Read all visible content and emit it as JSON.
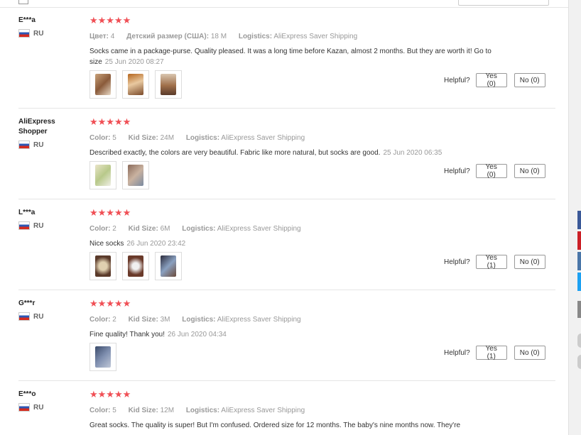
{
  "reviews": [
    {
      "user": "E***a",
      "country": "RU",
      "stars": "★★★★★",
      "attrs": [
        {
          "label": "Цвет:",
          "value": "4"
        },
        {
          "label": "Детский размер (США):",
          "value": "18 M"
        },
        {
          "label": "Logistics:",
          "value": "AliExpress Saver Shipping"
        }
      ],
      "text": "Socks came in a package-purse. Quality pleased. It was a long time before Kazan, almost 2 months. But they are worth it! Go to size",
      "date": "25 Jun 2020 08:27",
      "helpful_label": "Helpful?",
      "yes": "Yes (0)",
      "no": "No (0)"
    },
    {
      "user": "AliExpress Shopper",
      "country": "RU",
      "stars": "★★★★★",
      "attrs": [
        {
          "label": "Color:",
          "value": "5"
        },
        {
          "label": "Kid Size:",
          "value": "24M"
        },
        {
          "label": "Logistics:",
          "value": "AliExpress Saver Shipping"
        }
      ],
      "text": "Described exactly, the colors are very beautiful. Fabric like more natural, but socks are good.",
      "date": "25 Jun 2020 06:35",
      "helpful_label": "Helpful?",
      "yes": "Yes (0)",
      "no": "No (0)"
    },
    {
      "user": "L***a",
      "country": "RU",
      "stars": "★★★★★",
      "attrs": [
        {
          "label": "Color:",
          "value": "2"
        },
        {
          "label": "Kid Size:",
          "value": "6M"
        },
        {
          "label": "Logistics:",
          "value": "AliExpress Saver Shipping"
        }
      ],
      "text": "Nice socks",
      "date": "26 Jun 2020 23:42",
      "helpful_label": "Helpful?",
      "yes": "Yes (1)",
      "no": "No (0)"
    },
    {
      "user": "G***r",
      "country": "RU",
      "stars": "★★★★★",
      "attrs": [
        {
          "label": "Color:",
          "value": "2"
        },
        {
          "label": "Kid Size:",
          "value": "3M"
        },
        {
          "label": "Logistics:",
          "value": "AliExpress Saver Shipping"
        }
      ],
      "text": "Fine quality! Thank you!",
      "date": "26 Jun 2020 04:34",
      "helpful_label": "Helpful?",
      "yes": "Yes (1)",
      "no": "No (0)"
    },
    {
      "user": "E***o",
      "country": "RU",
      "stars": "★★★★★",
      "attrs": [
        {
          "label": "Color:",
          "value": "5"
        },
        {
          "label": "Kid Size:",
          "value": "12M"
        },
        {
          "label": "Logistics:",
          "value": "AliExpress Saver Shipping"
        }
      ],
      "text": "Great socks. The quality is super! But I'm confused. Ordered size for 12 months. The baby's nine months now. They're",
      "date": ""
    }
  ],
  "colors": {
    "star": "#f04f55",
    "social": [
      "#3b5998",
      "#cb2027",
      "#4a76a8",
      "#1da1f2",
      "#888888",
      "#cccccc"
    ]
  }
}
